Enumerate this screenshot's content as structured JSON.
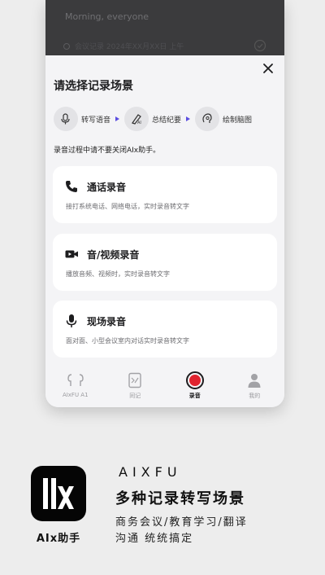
{
  "phone": {
    "greeting": "Morning, everyone",
    "top_sub": "会议记录 2024年XX月XX日 上午"
  },
  "sheet": {
    "title": "请选择记录场景",
    "close_icon": "close-icon",
    "steps": [
      {
        "label": "转写语音",
        "icon": "transcribe-icon"
      },
      {
        "label": "总结纪要",
        "icon": "ai-summary-icon"
      },
      {
        "label": "绘制脑图",
        "icon": "mindmap-icon"
      }
    ],
    "notice": "录音过程中请不要关闭AIx助手。",
    "cards": [
      {
        "title": "通话录音",
        "desc": "接打系统电话、网络电话，实时录音转文字",
        "icon": "phone-icon"
      },
      {
        "title": "音/视频录音",
        "desc": "播放音频、视频时，实时录音转文字",
        "icon": "video-camera-icon"
      },
      {
        "title": "现场录音",
        "desc": "面对面、小型会议室内对话实时录音转文字",
        "icon": "microphone-icon"
      }
    ]
  },
  "tabbar": {
    "tabs": [
      {
        "label": "AIxFU A1",
        "icon": "earbuds-icon",
        "active": false
      },
      {
        "label": "同记",
        "icon": "notes-icon",
        "active": false
      },
      {
        "label": "录音",
        "icon": "record-icon",
        "active": true
      },
      {
        "label": "我的",
        "icon": "profile-icon",
        "active": false
      }
    ]
  },
  "promo": {
    "logo_caption": "AIx助手",
    "brand": "AIXFU",
    "headline": "多种记录转写场景",
    "tagline_1": "商务会议/教育学习/翻译",
    "tagline_2": "沟通 统统搞定"
  },
  "colors": {
    "accent": "#5b4de0",
    "record_red": "#e0242f",
    "phone_header": "#3b3b3d",
    "card_bg": "#ffffff",
    "page_bg": "#ededed"
  }
}
